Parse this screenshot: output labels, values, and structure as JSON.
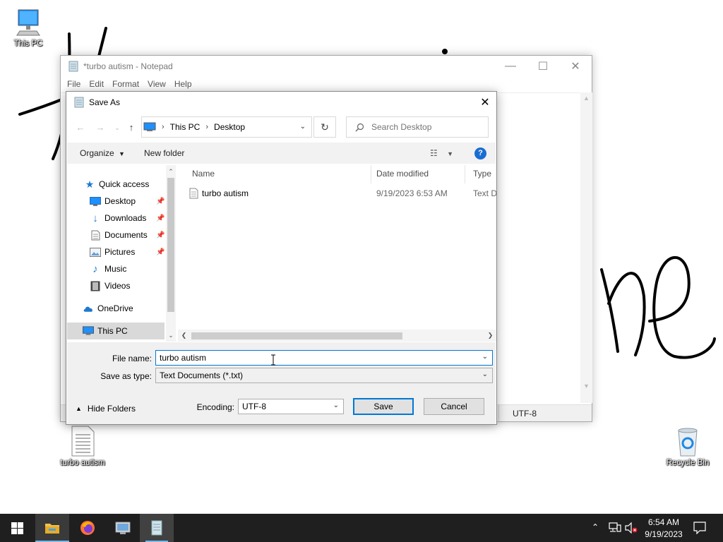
{
  "desktop": {
    "icons": [
      {
        "label": "This PC",
        "icon": "monitor-icon"
      },
      {
        "label": "turbo autism",
        "icon": "text-file-icon"
      },
      {
        "label": "Recycle Bin",
        "icon": "recycle-bin-icon"
      }
    ]
  },
  "notepad": {
    "title": "*turbo autism - Notepad",
    "menu": [
      "File",
      "Edit",
      "Format",
      "View",
      "Help"
    ],
    "status_encoding": "UTF-8"
  },
  "save_dialog": {
    "title": "Save As",
    "breadcrumb": [
      "This PC",
      "Desktop"
    ],
    "search_placeholder": "Search Desktop",
    "toolbar": {
      "organize": "Organize",
      "new_folder": "New folder",
      "help": "?"
    },
    "nav": {
      "quick_access": "Quick access",
      "items": [
        {
          "label": "Desktop",
          "icon": "desktop-folder-icon",
          "pinned": true
        },
        {
          "label": "Downloads",
          "icon": "download-arrow-icon",
          "pinned": true
        },
        {
          "label": "Documents",
          "icon": "documents-icon",
          "pinned": true
        },
        {
          "label": "Pictures",
          "icon": "pictures-icon",
          "pinned": true
        },
        {
          "label": "Music",
          "icon": "music-note-icon",
          "pinned": false
        },
        {
          "label": "Videos",
          "icon": "film-strip-icon",
          "pinned": false
        }
      ],
      "onedrive": "OneDrive",
      "this_pc": "This PC"
    },
    "columns": [
      "Name",
      "Date modified",
      "Type"
    ],
    "files": [
      {
        "name": "turbo autism",
        "date_modified": "9/19/2023 6:53 AM",
        "type": "Text D"
      }
    ],
    "file_name_label": "File name:",
    "file_name_value": "turbo autism",
    "save_type_label": "Save as type:",
    "save_type_value": "Text Documents (*.txt)",
    "encoding_label": "Encoding:",
    "encoding_value": "UTF-8",
    "save_button": "Save",
    "cancel_button": "Cancel",
    "hide_folders": "Hide Folders"
  },
  "taskbar": {
    "apps": [
      "windows-start-icon",
      "file-explorer-icon",
      "firefox-icon",
      "control-panel-icon",
      "notepad-icon"
    ],
    "time": "6:54 AM",
    "date": "9/19/2023"
  },
  "colors": {
    "accent": "#0078d7",
    "taskbar": "#1f1f1f",
    "help": "#1a6ed1"
  }
}
